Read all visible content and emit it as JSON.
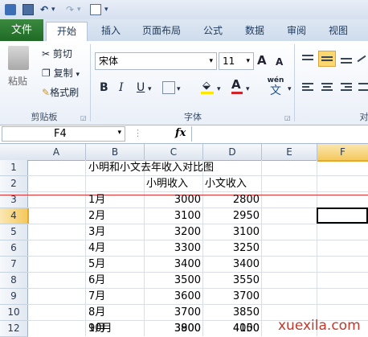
{
  "quick_access": {
    "undo_label": "↶",
    "redo_label": "↷"
  },
  "tabs": [
    "文件",
    "开始",
    "插入",
    "页面布局",
    "公式",
    "数据",
    "审阅",
    "视图"
  ],
  "clipboard": {
    "paste": "粘贴",
    "cut": "剪切",
    "copy": "复制",
    "format_painter": "格式刷",
    "group": "剪贴板"
  },
  "font": {
    "name": "宋体",
    "size": "11",
    "bold": "B",
    "italic": "I",
    "underline": "U",
    "group": "字体",
    "grow": "A",
    "shrink": "A",
    "wen": "wén",
    "wen_char": "文"
  },
  "alignment": {
    "group_partial": "对"
  },
  "formula_bar": {
    "name_box": "F4",
    "fx": "fx",
    "value": ""
  },
  "columns": [
    "A",
    "B",
    "C",
    "D",
    "E",
    "F"
  ],
  "rows": [
    "1",
    "2",
    "3",
    "4",
    "5",
    "6",
    "7",
    "8",
    "9",
    "10",
    "11",
    "12"
  ],
  "sheet": {
    "title": "小明和小文去年收入对比图",
    "header_c": "小明收入",
    "header_d": "小文收入",
    "data": [
      {
        "month": "1月",
        "c": "3000",
        "d": "2800"
      },
      {
        "month": "2月",
        "c": "3100",
        "d": "2950"
      },
      {
        "month": "3月",
        "c": "3200",
        "d": "3100"
      },
      {
        "month": "4月",
        "c": "3300",
        "d": "3250"
      },
      {
        "month": "5月",
        "c": "3400",
        "d": "3400"
      },
      {
        "month": "6月",
        "c": "3500",
        "d": "3550"
      },
      {
        "month": "7月",
        "c": "3600",
        "d": "3700"
      },
      {
        "month": "8月",
        "c": "3700",
        "d": "3850"
      },
      {
        "month": "9月",
        "c": "3800",
        "d": "4000"
      },
      {
        "month": "10月",
        "c": "3900",
        "d": "4150"
      }
    ]
  },
  "watermark": "xuexila.com",
  "colors": {
    "file_tab": "#2a7a30",
    "selection": "#000000",
    "red_line": "#e03030",
    "active_header": "#f9d77e"
  }
}
